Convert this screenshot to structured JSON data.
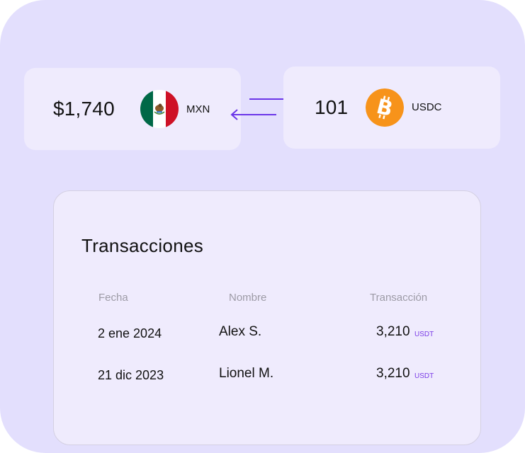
{
  "converter": {
    "from": {
      "amount": "$1,740",
      "currency": "MXN",
      "icon": "mexico-flag-icon"
    },
    "to": {
      "amount": "101",
      "currency": "USDC",
      "icon": "bitcoin-icon"
    },
    "swap_icon": "swap-arrows-icon"
  },
  "transactions": {
    "title": "Transacciones",
    "columns": [
      "Fecha",
      "Nombre",
      "Transacción"
    ],
    "rows": [
      {
        "date": "2 ene 2024",
        "name": "Alex S.",
        "amount": "3,210",
        "unit": "USDT"
      },
      {
        "date": "21 dic 2023",
        "name": "Lionel M.",
        "amount": "3,210",
        "unit": "USDT"
      }
    ]
  },
  "colors": {
    "background": "#e3dffd",
    "card": "#efebfd",
    "accent": "#6a35e8",
    "bitcoin": "#f7931a",
    "flag_green": "#006847",
    "flag_red": "#ce1126"
  }
}
